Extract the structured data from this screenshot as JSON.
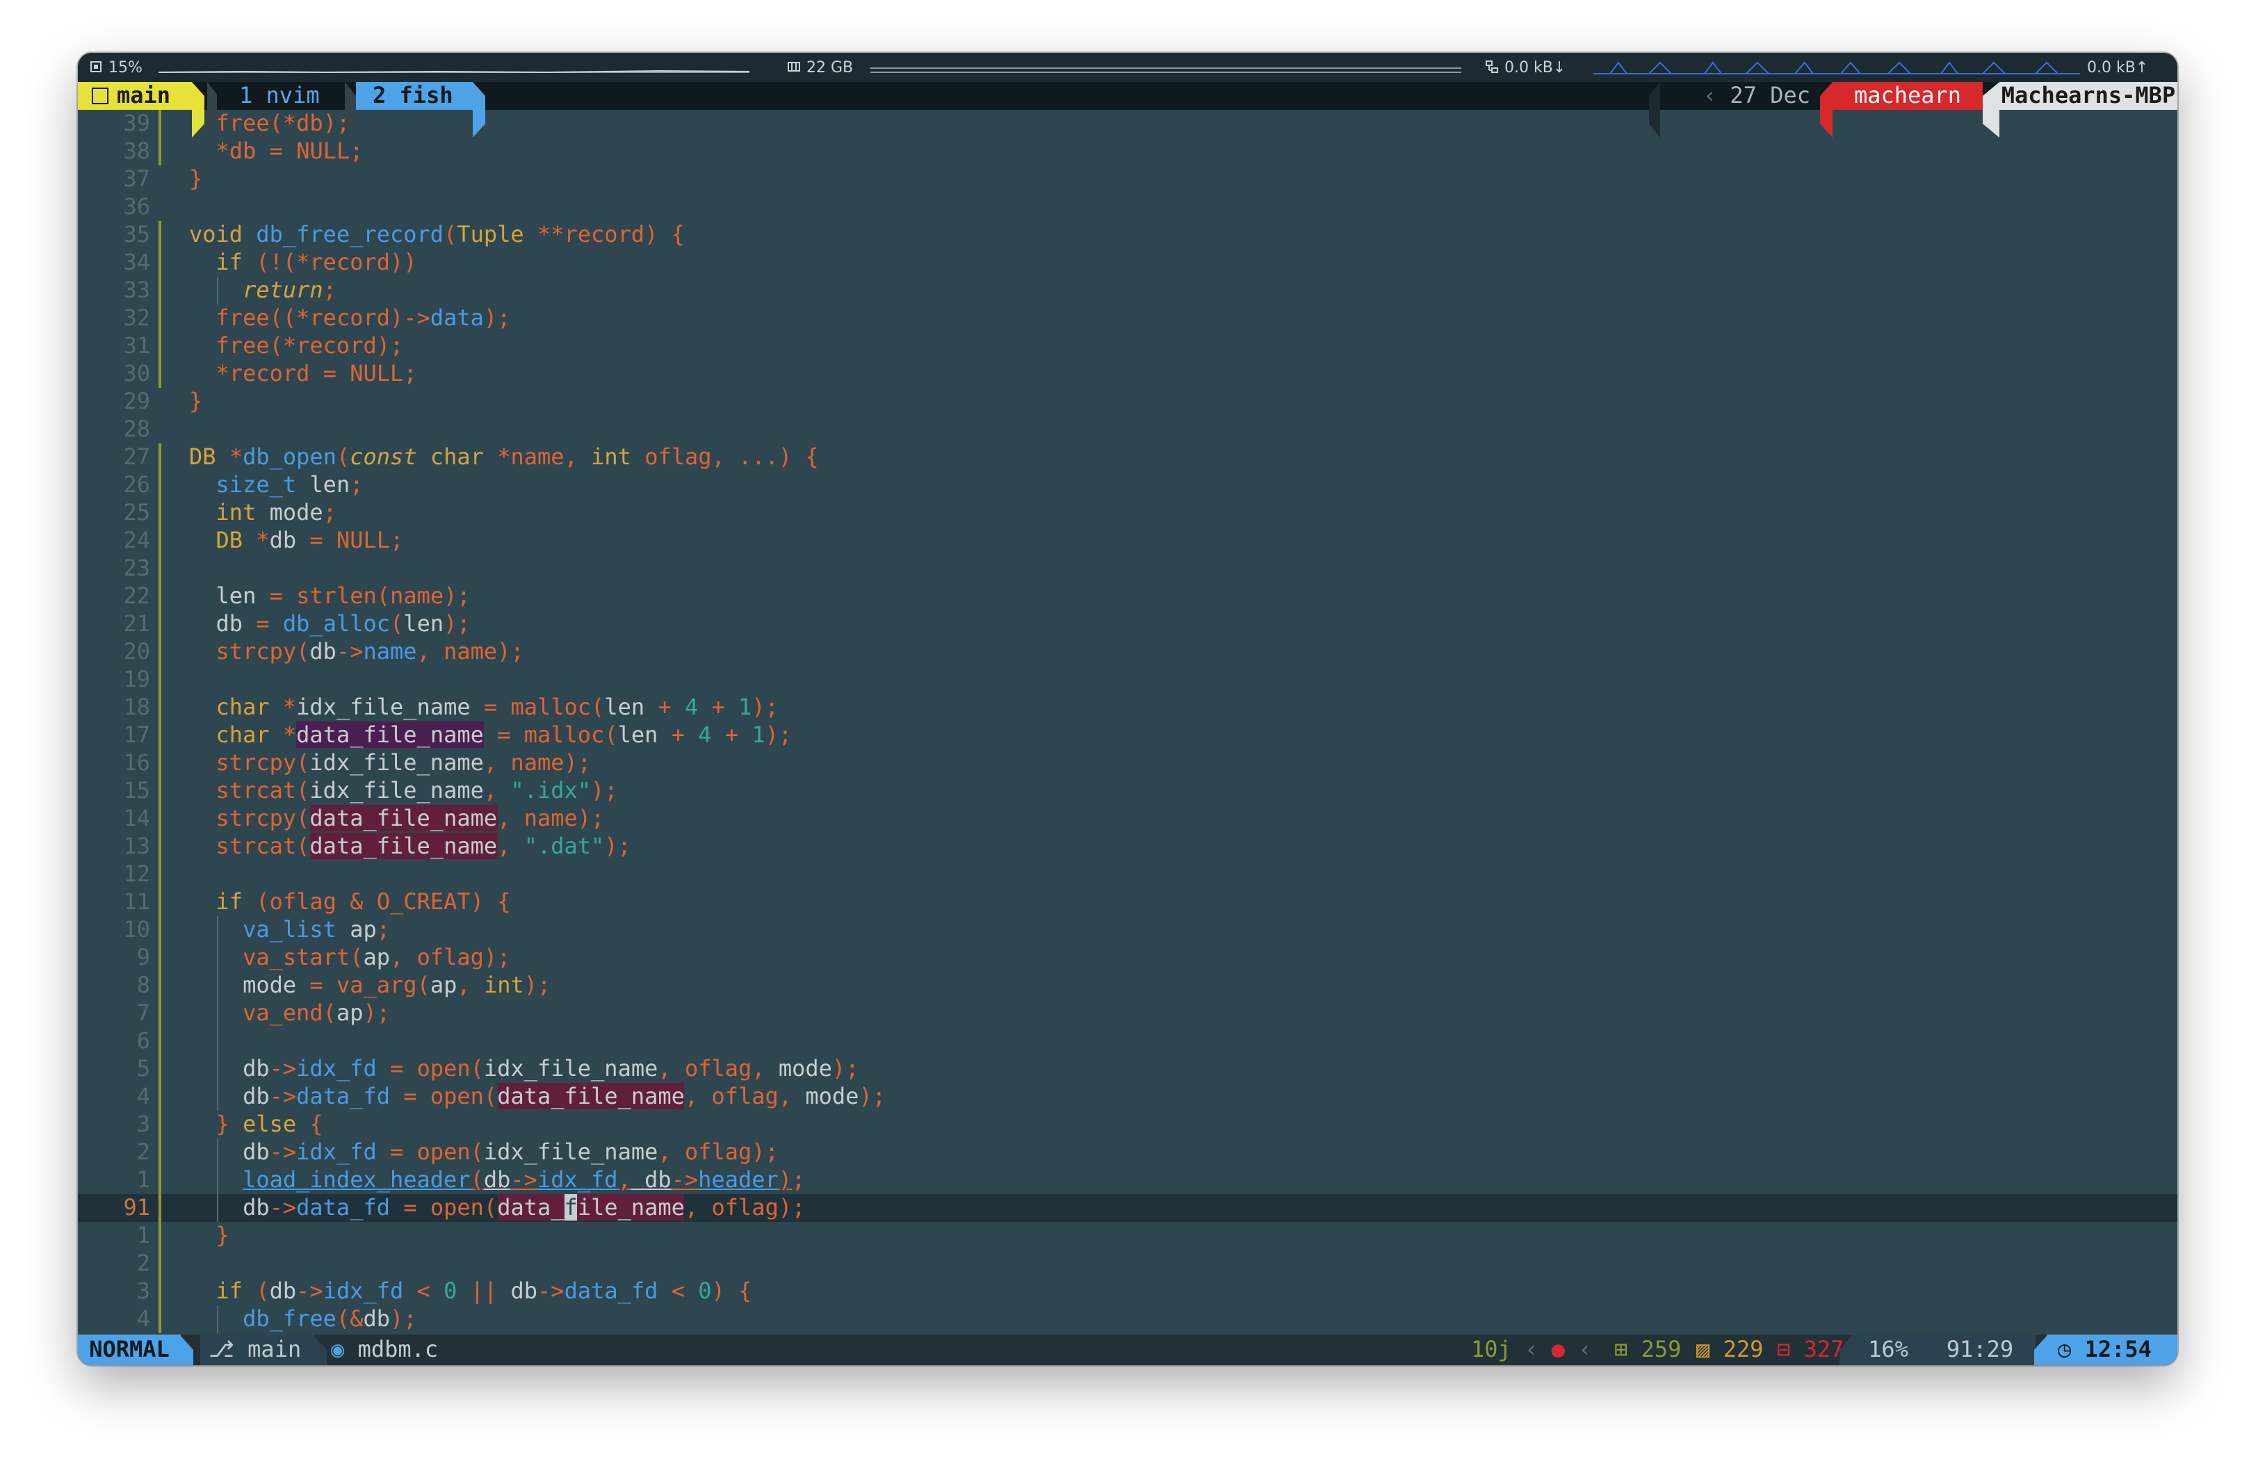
{
  "sysbar": {
    "cpu": "15%",
    "memory": "22 GB",
    "net_down": "0.0 kB↓",
    "net_up": "0.0 kB↑"
  },
  "tmux": {
    "session": "main",
    "windows": [
      "1 nvim",
      "2 fish"
    ],
    "date": "27 Dec",
    "user": "machearn",
    "host": "Machearns-MBP"
  },
  "editor": {
    "line_numbers": [
      "39",
      "38",
      "37",
      "36",
      "35",
      "34",
      "33",
      "32",
      "31",
      "30",
      "29",
      "28",
      "27",
      "26",
      "25",
      "24",
      "23",
      "22",
      "21",
      "20",
      "19",
      "18",
      "17",
      "16",
      "15",
      "14",
      "13",
      "12",
      "11",
      "10",
      "9",
      "8",
      "7",
      "6",
      "5",
      "4",
      "3",
      "2",
      "1",
      "91",
      "1",
      "2",
      "3",
      "4"
    ],
    "lines": [
      "  free(*db);",
      "  *db = NULL;",
      "}",
      "",
      "void db_free_record(Tuple **record) {",
      "  if (!(*record))",
      "    return;",
      "  free((*record)->data);",
      "  free(*record);",
      "  *record = NULL;",
      "}",
      "",
      "DB *db_open(const char *name, int oflag, ...) {",
      "  size_t len;",
      "  int mode;",
      "  DB *db = NULL;",
      "",
      "  len = strlen(name);",
      "  db = db_alloc(len);",
      "  strcpy(db->name, name);",
      "",
      "  char *idx_file_name = malloc(len + 4 + 1);",
      "  char *data_file_name = malloc(len + 4 + 1);",
      "  strcpy(idx_file_name, name);",
      "  strcat(idx_file_name, \".idx\");",
      "  strcpy(data_file_name, name);",
      "  strcat(data_file_name, \".dat\");",
      "",
      "  if (oflag & O_CREAT) {",
      "    va_list ap;",
      "    va_start(ap, oflag);",
      "    mode = va_arg(ap, int);",
      "    va_end(ap);",
      "",
      "    db->idx_fd = open(idx_file_name, oflag, mode);",
      "    db->data_fd = open(data_file_name, oflag, mode);",
      "  } else {",
      "    db->idx_fd = open(idx_file_name, oflag);",
      "    load_index_header(db->idx_fd, db->header);",
      "    db->data_fd = open(data_file_name, oflag);",
      "  }",
      "",
      "  if (db->idx_fd < 0 || db->data_fd < 0) {",
      "    db_free(&db);"
    ]
  },
  "status": {
    "mode": "NORMAL",
    "branch": "main",
    "file": "mdbm.c",
    "jumps": "10j",
    "added": "259",
    "changed": "229",
    "removed": "327",
    "percent": "16%",
    "position": "91:29",
    "time": "12:54"
  }
}
